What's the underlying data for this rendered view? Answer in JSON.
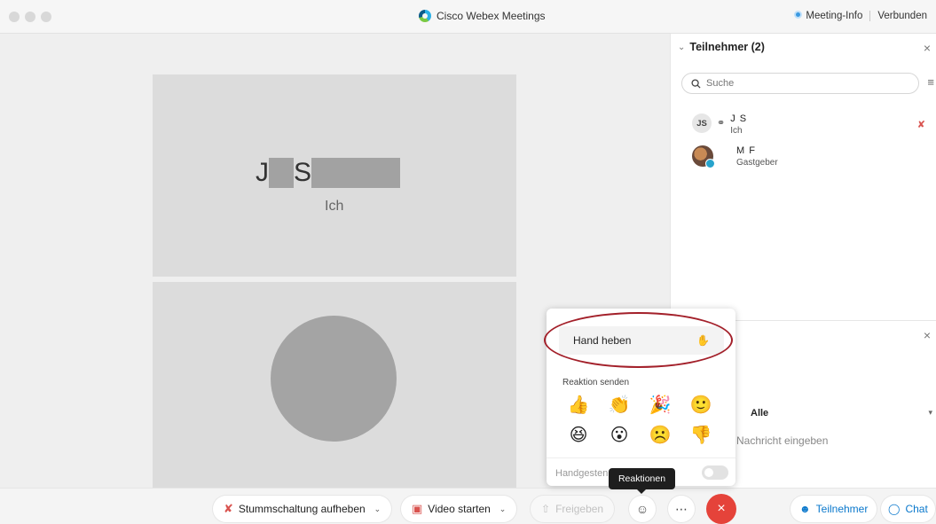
{
  "window": {
    "title": "Cisco Webex Meetings",
    "meeting_info": "Meeting-Info",
    "connection": "Verbunden"
  },
  "stage": {
    "self_tile": {
      "name_first": "J",
      "name_last": "S",
      "subtitle": "Ich"
    }
  },
  "participants_panel": {
    "title": "Teilnehmer (2)",
    "search_placeholder": "Suche",
    "participants": [
      {
        "initials": "JS",
        "name": "J    S",
        "role": "Ich"
      },
      {
        "name": "M     F",
        "role": "Gastgeber"
      }
    ]
  },
  "chat_panel": {
    "to_label": "Alle",
    "input_placeholder": "Nachricht eingeben"
  },
  "reactions_popup": {
    "raise_hand": "Hand heben",
    "send_reaction_label": "Reaktion senden",
    "emojis": [
      "👍",
      "👏",
      "🎉",
      "🙂",
      "😆",
      "😮",
      "☹️",
      "👎"
    ],
    "hand_gestures_label": "Handgesten",
    "tooltip": "Reaktionen"
  },
  "toolbar": {
    "unmute": "Stummschaltung aufheben",
    "start_video": "Video starten",
    "share": "Freigeben",
    "participants": "Teilnehmer",
    "chat": "Chat"
  },
  "colors": {
    "end_call": "#e5433a",
    "highlight_ring": "#a3202a",
    "accent": "#0a78cc"
  }
}
